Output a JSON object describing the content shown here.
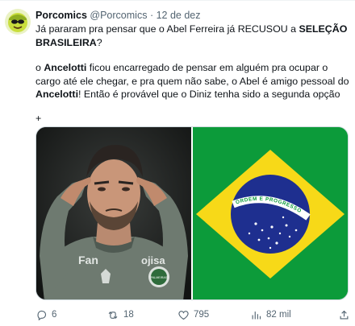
{
  "tweet": {
    "author_name": "Porcomics",
    "author_handle": "@Porcomics",
    "separator": "·",
    "date": "12 de dez",
    "text": {
      "l1_a": "Já pararam pra pensar que o Abel Ferreira já RECUSOU a ",
      "l1_b": "SELEÇÃO BRASILEIRA",
      "l1_c": "?",
      "l2_a": "o ",
      "l2_b": "Ancelotti",
      "l2_c": " ficou encarregado de pensar em alguém pra ocupar o cargo até ele chegar, e pra quem não sabe, o Abel é amigo pessoal do ",
      "l2_d": "Ancelotti",
      "l2_e": "! Então é provável que o Diniz tenha sido a segunda opção",
      "plus": "+"
    },
    "media": {
      "photo_icon": "coach-portrait-photo",
      "shirt_text": "Fan",
      "shirt_text2": "ojisa",
      "crest_text": "PALMEIRAS",
      "flag_icon": "brazil-flag",
      "flag_motto": "ORDEM E PROGRESSO"
    },
    "stats": {
      "replies": "6",
      "retweets": "18",
      "likes": "795",
      "views": "82 mil"
    }
  },
  "colors": {
    "text": "#0f1419",
    "muted": "#536471",
    "flag_green": "#0c9b3a",
    "flag_yellow": "#f7d918",
    "flag_blue": "#1e2f8f"
  }
}
